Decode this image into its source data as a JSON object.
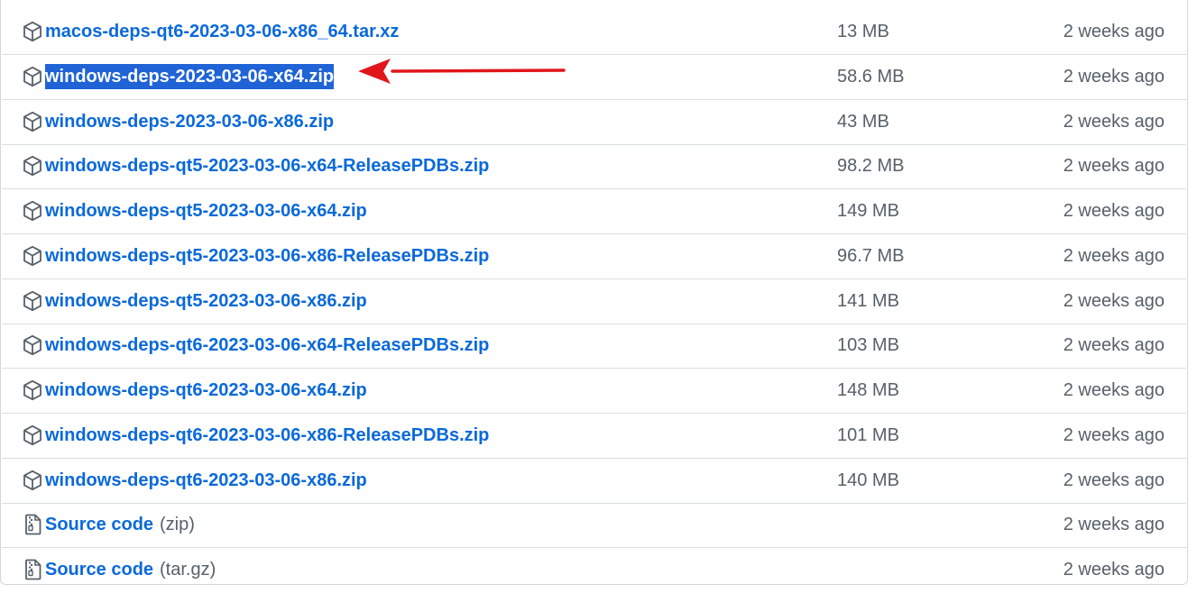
{
  "assets": [
    {
      "name": "macos-deps-qt6-2023-03-06-x86_64.tar.xz",
      "size": "13 MB",
      "time": "2 weeks ago",
      "icon": "package-icon"
    },
    {
      "name": "windows-deps-2023-03-06-x64.zip",
      "size": "58.6 MB",
      "time": "2 weeks ago",
      "icon": "package-icon",
      "selected": true
    },
    {
      "name": "windows-deps-2023-03-06-x86.zip",
      "size": "43 MB",
      "time": "2 weeks ago",
      "icon": "package-icon"
    },
    {
      "name": "windows-deps-qt5-2023-03-06-x64-ReleasePDBs.zip",
      "size": "98.2 MB",
      "time": "2 weeks ago",
      "icon": "package-icon"
    },
    {
      "name": "windows-deps-qt5-2023-03-06-x64.zip",
      "size": "149 MB",
      "time": "2 weeks ago",
      "icon": "package-icon"
    },
    {
      "name": "windows-deps-qt5-2023-03-06-x86-ReleasePDBs.zip",
      "size": "96.7 MB",
      "time": "2 weeks ago",
      "icon": "package-icon"
    },
    {
      "name": "windows-deps-qt5-2023-03-06-x86.zip",
      "size": "141 MB",
      "time": "2 weeks ago",
      "icon": "package-icon"
    },
    {
      "name": "windows-deps-qt6-2023-03-06-x64-ReleasePDBs.zip",
      "size": "103 MB",
      "time": "2 weeks ago",
      "icon": "package-icon"
    },
    {
      "name": "windows-deps-qt6-2023-03-06-x64.zip",
      "size": "148 MB",
      "time": "2 weeks ago",
      "icon": "package-icon"
    },
    {
      "name": "windows-deps-qt6-2023-03-06-x86-ReleasePDBs.zip",
      "size": "101 MB",
      "time": "2 weeks ago",
      "icon": "package-icon"
    },
    {
      "name": "windows-deps-qt6-2023-03-06-x86.zip",
      "size": "140 MB",
      "time": "2 weeks ago",
      "icon": "package-icon"
    },
    {
      "name": "Source code",
      "suffix": "(zip)",
      "size": "",
      "time": "2 weeks ago",
      "icon": "file-zip-icon"
    },
    {
      "name": "Source code",
      "suffix": "(tar.gz)",
      "size": "",
      "time": "2 weeks ago",
      "icon": "file-zip-icon"
    }
  ],
  "colors": {
    "link": "#0969da",
    "muted": "#57606a",
    "border": "#d0d7de",
    "selection": "#1f63d6",
    "arrow": "#e0161b"
  },
  "annotation": {
    "icon": "red-arrow-icon"
  }
}
